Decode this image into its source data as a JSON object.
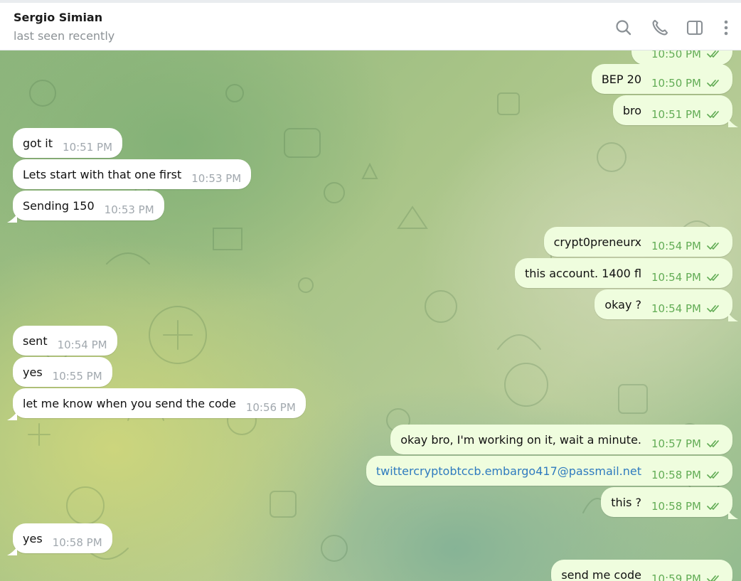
{
  "header": {
    "name": "Sergio Simian",
    "status": "last seen recently"
  },
  "icons": {
    "search": "search-icon",
    "call": "phone-icon",
    "sidebar": "sidebar-toggle-icon",
    "menu": "more-vertical-icon",
    "read": "double-check-icon"
  },
  "colors": {
    "incoming_bubble": "#ffffff",
    "outgoing_bubble": "#effdde",
    "outgoing_time": "#62ac55",
    "incoming_time": "#a1a8ae",
    "link": "#2f7bbf"
  },
  "messages": [
    {
      "dir": "out",
      "text": "",
      "time": "10:50 PM",
      "read": true
    },
    {
      "dir": "out",
      "text": "BEP 20",
      "time": "10:50 PM",
      "read": true
    },
    {
      "dir": "out",
      "text": "bro",
      "time": "10:51 PM",
      "read": true
    },
    {
      "dir": "in",
      "text": "got it",
      "time": "10:51 PM"
    },
    {
      "dir": "in",
      "text": "Lets start with that one first",
      "time": "10:53 PM"
    },
    {
      "dir": "in",
      "text": "Sending 150",
      "time": "10:53 PM"
    },
    {
      "dir": "out",
      "text": "crypt0preneurx",
      "time": "10:54 PM",
      "read": true
    },
    {
      "dir": "out",
      "text": "this account. 1400 fl",
      "time": "10:54 PM",
      "read": true
    },
    {
      "dir": "out",
      "text": "okay ?",
      "time": "10:54 PM",
      "read": true
    },
    {
      "dir": "in",
      "text": "sent",
      "time": "10:54 PM"
    },
    {
      "dir": "in",
      "text": "yes",
      "time": "10:55 PM"
    },
    {
      "dir": "in",
      "text": "let me know when you send the code",
      "time": "10:56 PM"
    },
    {
      "dir": "out",
      "text": "okay bro, I'm working on it, wait a minute.",
      "time": "10:57 PM",
      "read": true
    },
    {
      "dir": "out",
      "text": "twittercryptobtccb.embargo417@passmail.net",
      "time": "10:58 PM",
      "read": true,
      "is_link": true
    },
    {
      "dir": "out",
      "text": "this ?",
      "time": "10:58 PM",
      "read": true
    },
    {
      "dir": "in",
      "text": "yes",
      "time": "10:58 PM"
    },
    {
      "dir": "out",
      "text": "send me code",
      "time": "10:59 PM",
      "read": true
    }
  ]
}
